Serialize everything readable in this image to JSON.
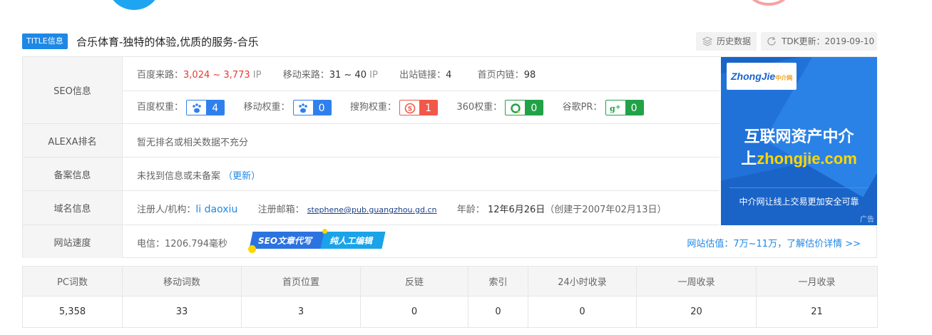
{
  "title": {
    "badge": "TITLE信息",
    "text": "合乐体育-独特的体验,优质的服务-合乐"
  },
  "actions": {
    "history": "历史数据",
    "tdk": "TDK更新：2019-09-10"
  },
  "seo": {
    "label": "SEO信息",
    "baidu_traffic_label": "百度来路：",
    "baidu_traffic_value": "3,024 ~ 3,773",
    "baidu_traffic_unit": "IP",
    "mobile_traffic_label": "移动来路：",
    "mobile_traffic_value": "31 ~ 40",
    "mobile_traffic_unit": "IP",
    "outlinks_label": "出站链接：",
    "outlinks_value": "4",
    "homelinks_label": "首页内链：",
    "homelinks_value": "98",
    "baidu_weight_label": "百度权重：",
    "baidu_weight_value": "4",
    "mobile_weight_label": "移动权重：",
    "mobile_weight_value": "0",
    "sogou_weight_label": "搜狗权重：",
    "sogou_weight_value": "1",
    "w360_label": "360权重：",
    "w360_value": "0",
    "google_pr_label": "谷歌PR：",
    "google_pr_value": "0"
  },
  "alexa": {
    "label": "ALEXA排名",
    "value": "暂无排名或相关数据不充分"
  },
  "beian": {
    "label": "备案信息",
    "value": "未找到信息或未备案",
    "update": "（更新）"
  },
  "domain": {
    "label": "域名信息",
    "registrant_label": "注册人/机构：",
    "registrant_value": "li daoxiu",
    "email_label": "注册邮箱：",
    "email_value": "stephene@pub.guangzhou.gd.cn",
    "age_label": "年龄：",
    "age_value": "12年6月26日",
    "created": "（创建于2007年02月13日）"
  },
  "speed": {
    "label": "网站速度",
    "value": "电信：1206.794毫秒",
    "banner_part1": "SEO文章代写",
    "banner_part2": "纯人工编辑",
    "estimate": "网站估值：7万~11万，了解估价详情 >>"
  },
  "ad": {
    "logo_text": "ZhongJie",
    "logo_sub": "中介网",
    "line1": "互联网资产中介",
    "line2_prefix": "上",
    "line2_domain": "zhongjie.com",
    "footer": "中介网让线上交易更加安全可靠",
    "tag": "广告"
  },
  "stats": {
    "headers": [
      "PC词数",
      "移动词数",
      "首页位置",
      "反链",
      "索引",
      "24小时收录",
      "一周收录",
      "一月收录"
    ],
    "values": [
      "5,358",
      "33",
      "3",
      "0",
      "0",
      "0",
      "20",
      "21"
    ]
  },
  "colors": {
    "accent": "#1e88e5",
    "red": "#e53935",
    "green": "#21a247",
    "ad_bg": "#1a64c8"
  }
}
